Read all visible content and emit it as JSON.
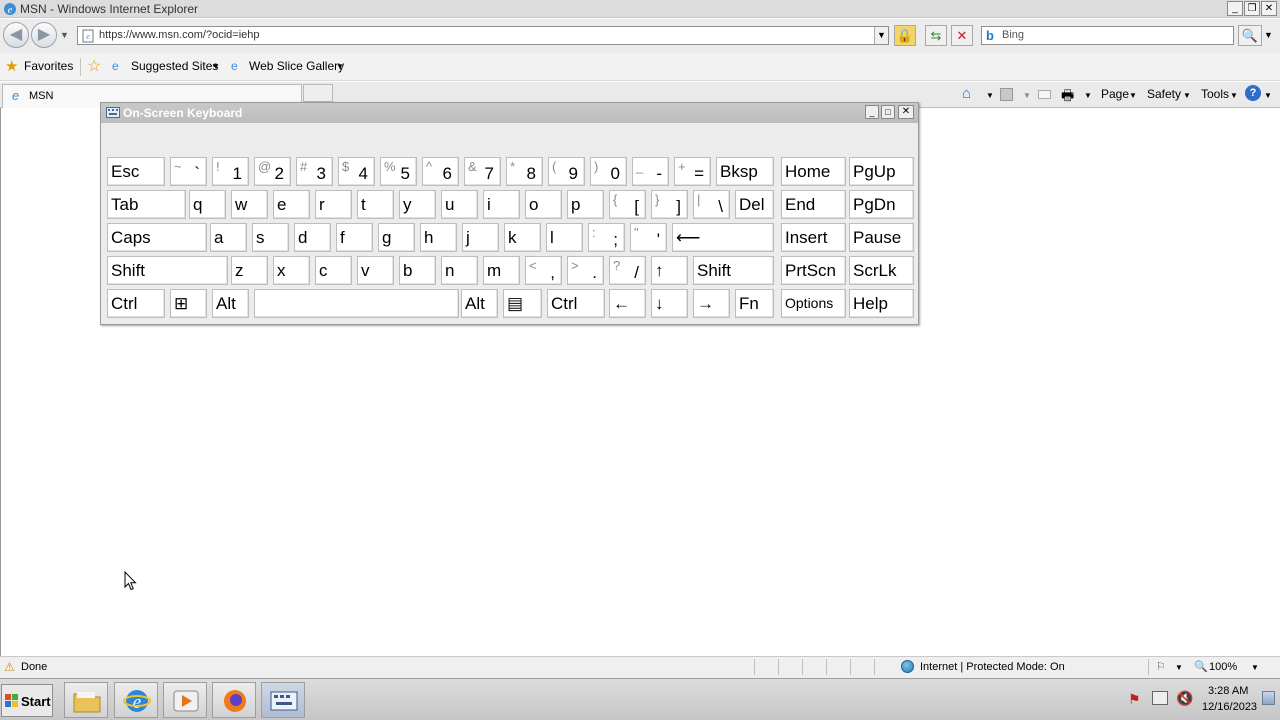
{
  "window": {
    "title": "MSN - Windows Internet Explorer"
  },
  "address": {
    "url": "https://www.msn.com/?ocid=iehp",
    "search_placeholder": "Bing"
  },
  "favorites_bar": {
    "favorites_label": "Favorites",
    "suggested_sites_label": "Suggested Sites",
    "web_slice_gallery_label": "Web Slice Gallery"
  },
  "tab": {
    "label": "MSN"
  },
  "commandbar": {
    "page_label": "Page",
    "safety_label": "Safety",
    "tools_label": "Tools"
  },
  "osk": {
    "title": "On-Screen Keyboard",
    "rows": [
      [
        {
          "label": "Esc"
        },
        {
          "shift": "~",
          "main": "`"
        },
        {
          "shift": "!",
          "main": "1"
        },
        {
          "shift": "@",
          "main": "2"
        },
        {
          "shift": "#",
          "main": "3"
        },
        {
          "shift": "$",
          "main": "4"
        },
        {
          "shift": "%",
          "main": "5"
        },
        {
          "shift": "^",
          "main": "6"
        },
        {
          "shift": "&",
          "main": "7"
        },
        {
          "shift": "*",
          "main": "8"
        },
        {
          "shift": "(",
          "main": "9"
        },
        {
          "shift": ")",
          "main": "0"
        },
        {
          "shift": "_",
          "main": "-"
        },
        {
          "shift": "+",
          "main": "="
        },
        {
          "label": "Bksp"
        },
        {
          "label": "Home"
        },
        {
          "label": "PgUp"
        }
      ],
      [
        {
          "label": "Tab"
        },
        {
          "label": "q"
        },
        {
          "label": "w"
        },
        {
          "label": "e"
        },
        {
          "label": "r"
        },
        {
          "label": "t"
        },
        {
          "label": "y"
        },
        {
          "label": "u"
        },
        {
          "label": "i"
        },
        {
          "label": "o"
        },
        {
          "label": "p"
        },
        {
          "shift": "{",
          "main": "["
        },
        {
          "shift": "}",
          "main": "]"
        },
        {
          "shift": "|",
          "main": "\\"
        },
        {
          "label": "Del"
        },
        {
          "label": "End"
        },
        {
          "label": "PgDn"
        }
      ],
      [
        {
          "label": "Caps"
        },
        {
          "label": "a"
        },
        {
          "label": "s"
        },
        {
          "label": "d"
        },
        {
          "label": "f"
        },
        {
          "label": "g"
        },
        {
          "label": "h"
        },
        {
          "label": "j"
        },
        {
          "label": "k"
        },
        {
          "label": "l"
        },
        {
          "shift": ":",
          "main": ";"
        },
        {
          "shift": "\"",
          "main": "'"
        },
        {
          "label": "⟵"
        },
        {
          "label": "Insert"
        },
        {
          "label": "Pause"
        }
      ],
      [
        {
          "label": "Shift"
        },
        {
          "label": "z"
        },
        {
          "label": "x"
        },
        {
          "label": "c"
        },
        {
          "label": "v"
        },
        {
          "label": "b"
        },
        {
          "label": "n"
        },
        {
          "label": "m"
        },
        {
          "shift": "<",
          "main": ","
        },
        {
          "shift": ">",
          "main": "."
        },
        {
          "shift": "?",
          "main": "/"
        },
        {
          "label": "↑"
        },
        {
          "label": "Shift"
        },
        {
          "label": "PrtScn"
        },
        {
          "label": "ScrLk"
        }
      ],
      [
        {
          "label": "Ctrl"
        },
        {
          "label": "⊞"
        },
        {
          "label": "Alt"
        },
        {
          "label": ""
        },
        {
          "label": "Alt"
        },
        {
          "label": "▤"
        },
        {
          "label": "Ctrl"
        },
        {
          "label": "←"
        },
        {
          "label": "↓"
        },
        {
          "label": "→"
        },
        {
          "label": "Fn"
        },
        {
          "label": "Options"
        },
        {
          "label": "Help"
        }
      ]
    ]
  },
  "status": {
    "text": "Done",
    "zone": "Internet | Protected Mode: On",
    "zoom": "100%"
  },
  "taskbar": {
    "start_label": "Start",
    "time": "3:28 AM",
    "date": "12/16/2023"
  }
}
